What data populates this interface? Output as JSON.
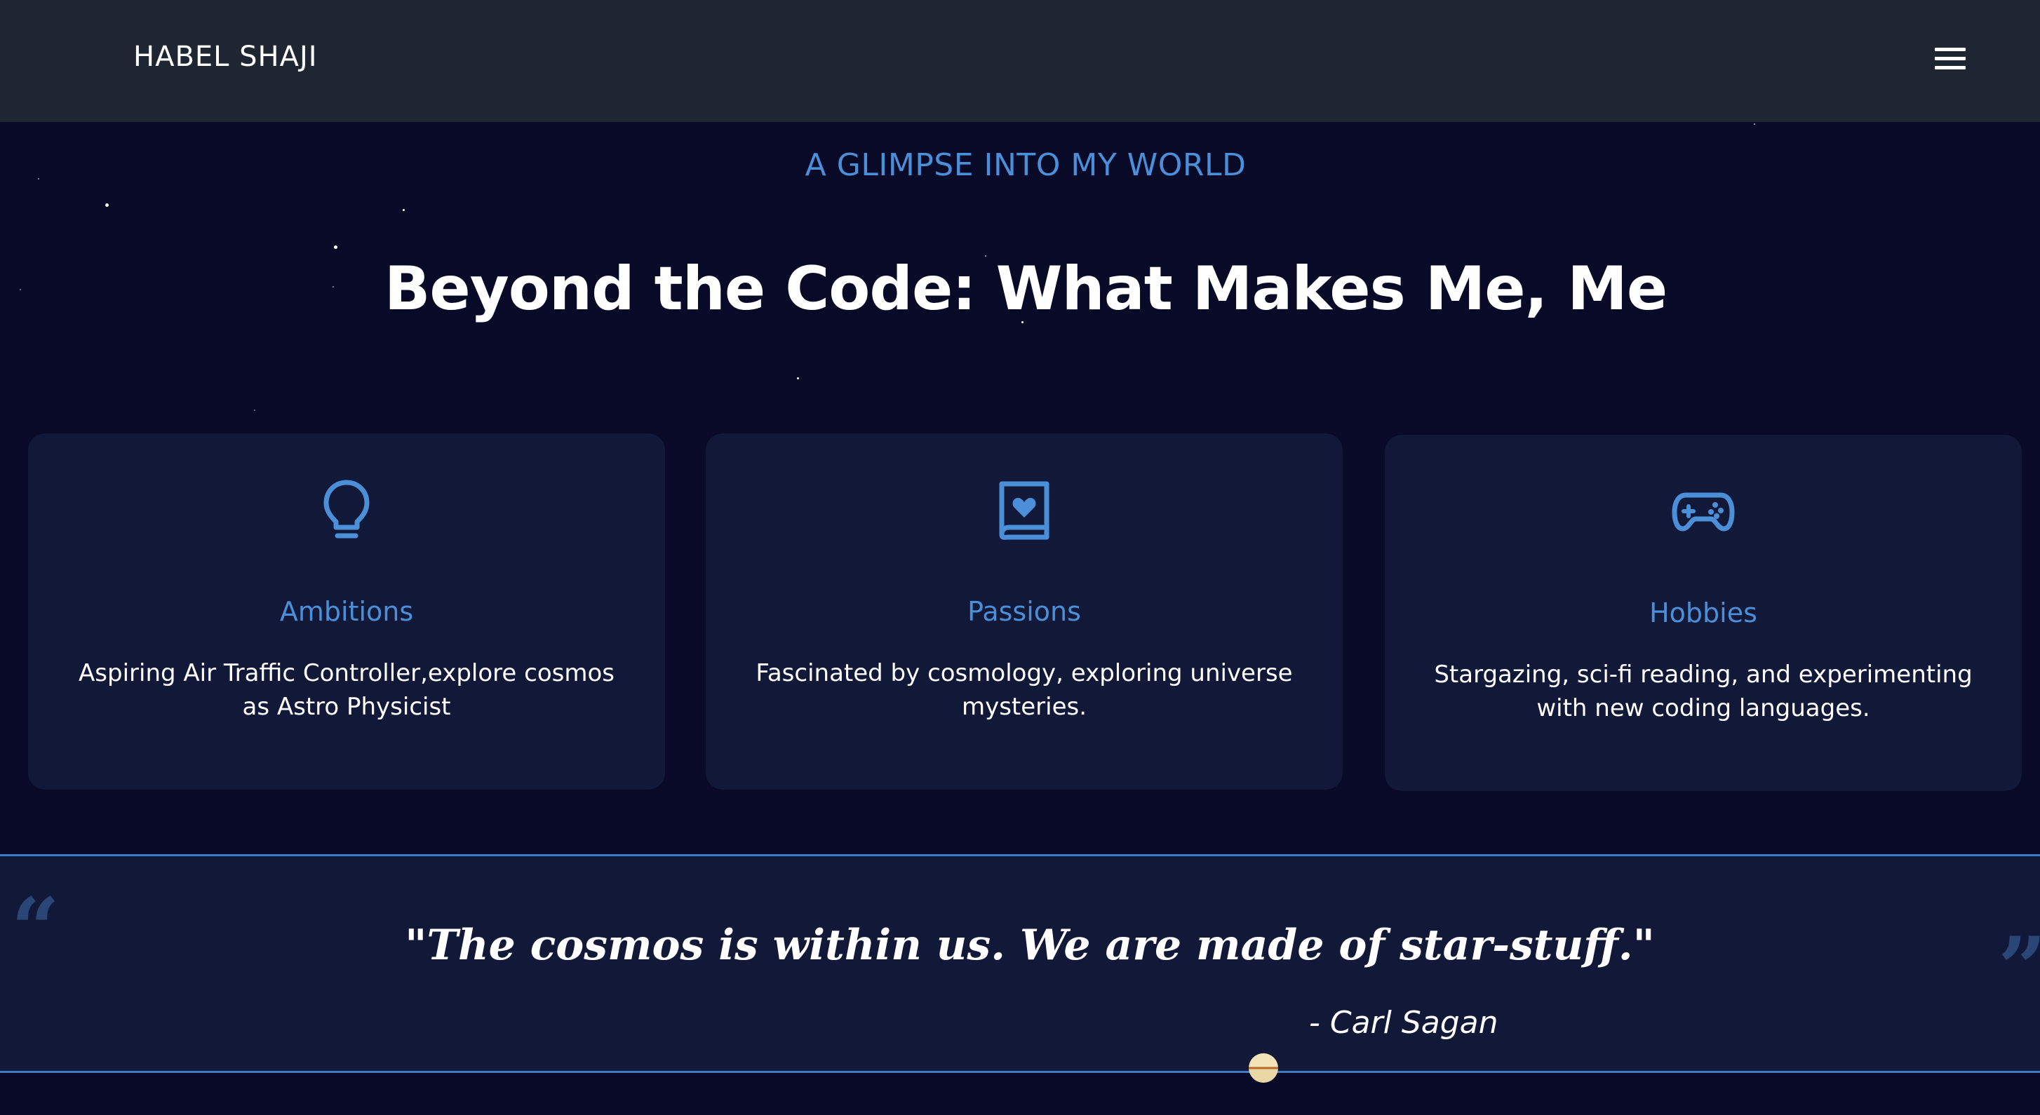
{
  "header": {
    "brand": "HABEL SHAJI",
    "menu_icon": "hamburger-icon"
  },
  "section": {
    "eyebrow": "A GLIMPSE INTO MY WORLD",
    "title": "Beyond the Code: What Makes Me, Me"
  },
  "cards": [
    {
      "icon": "lightbulb-icon",
      "title": "Ambitions",
      "text": "Aspiring Air Traffic Controller,explore cosmos as Astro Physicist"
    },
    {
      "icon": "book-heart-icon",
      "title": "Passions",
      "text": "Fascinated by cosmology, exploring universe mysteries."
    },
    {
      "icon": "gamepad-icon",
      "title": "Hobbies",
      "text": "Stargazing, sci-fi reading, and experimenting with new coding languages."
    }
  ],
  "quote": {
    "text": "\"The cosmos is within us. We are made of star-stuff.\"",
    "author": "- Carl Sagan",
    "open_mark": "“",
    "close_mark": "”"
  },
  "colors": {
    "background": "#080a27",
    "header": "#1e2731",
    "card": "#111838",
    "accent": "#4a8fd8"
  }
}
